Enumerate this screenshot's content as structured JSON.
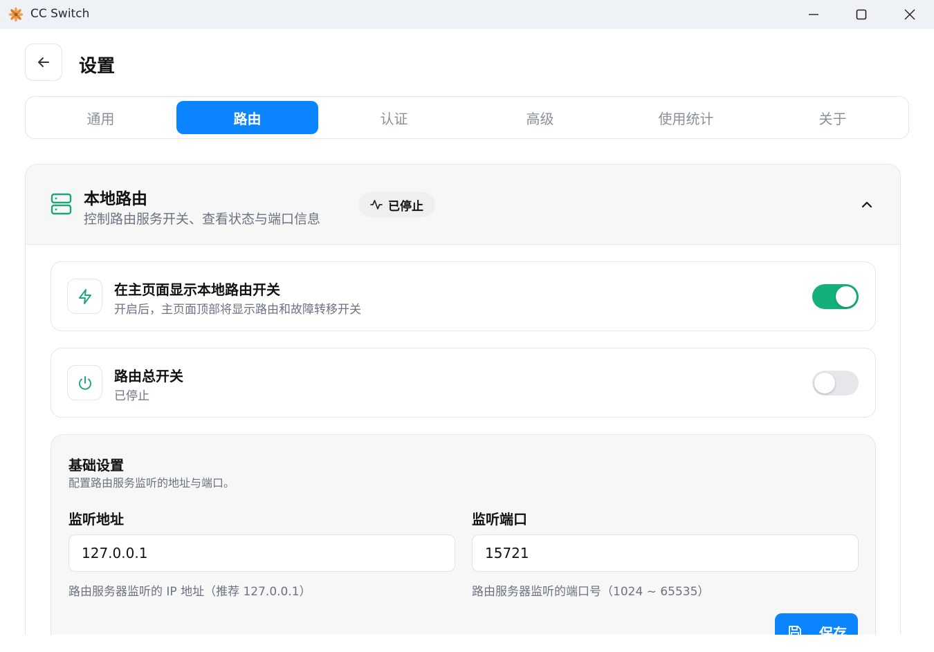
{
  "window": {
    "title": "CC Switch",
    "logo_icon": "flower-logo-icon"
  },
  "header": {
    "title": "设置",
    "back_icon": "arrow-left-icon"
  },
  "tabs": [
    {
      "label": "通用",
      "active": false
    },
    {
      "label": "路由",
      "active": true
    },
    {
      "label": "认证",
      "active": false
    },
    {
      "label": "高级",
      "active": false
    },
    {
      "label": "使用统计",
      "active": false
    },
    {
      "label": "关于",
      "active": false
    }
  ],
  "section": {
    "title": "本地路由",
    "description": "控制路由服务开关、查看状态与端口信息",
    "status": "已停止",
    "status_icon": "activity-icon",
    "icon": "server-icon",
    "collapse_icon": "chevron-up-icon"
  },
  "rows": [
    {
      "title": "在主页面显示本地路由开关",
      "subtitle": "开启后，主页面顶部将显示路由和故障转移开关",
      "icon": "lightning-icon",
      "enabled": true
    },
    {
      "title": "路由总开关",
      "subtitle": "已停止",
      "icon": "power-icon",
      "enabled": false
    }
  ],
  "basic": {
    "title": "基础设置",
    "description": "配置路由服务监听的地址与端口。",
    "address": {
      "label": "监听地址",
      "value": "127.0.0.1",
      "help": "路由服务器监听的 IP 地址（推荐 127.0.0.1）"
    },
    "port": {
      "label": "监听端口",
      "value": "15721",
      "help": "路由服务器监听的端口号（1024 ~ 65535）"
    },
    "save_label": "保存",
    "save_icon": "save-icon"
  },
  "colors": {
    "accent": "#0a84ff",
    "toggle_on": "#13b07a",
    "icon_green": "#1aa57a"
  }
}
